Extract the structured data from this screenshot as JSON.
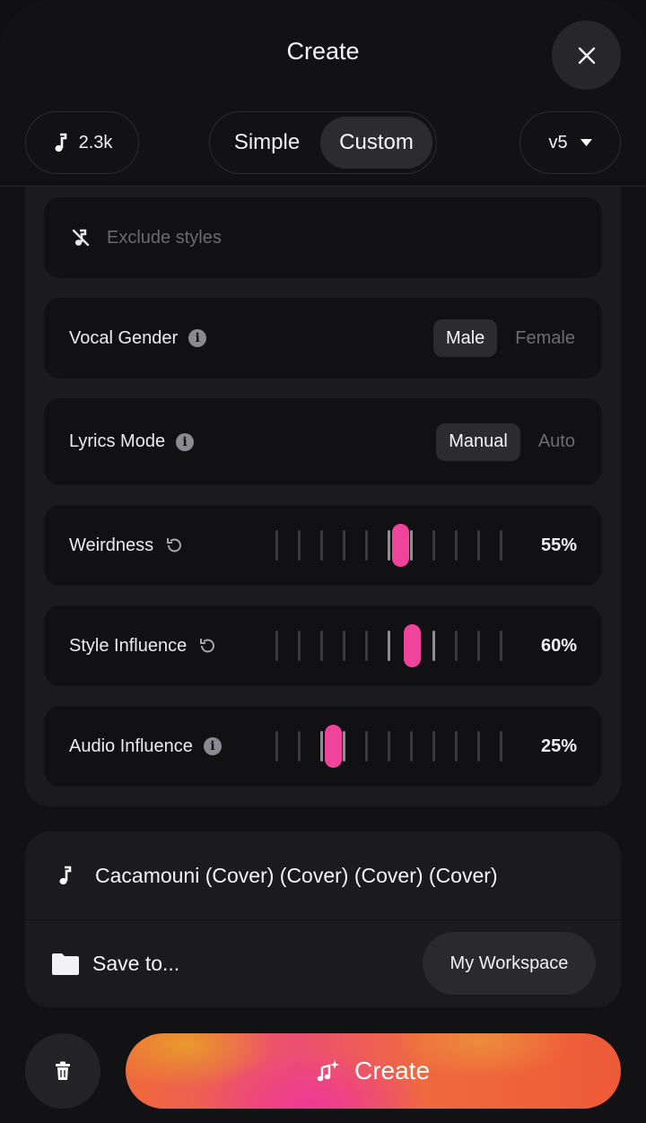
{
  "header": {
    "title": "Create"
  },
  "toolbar": {
    "credits": "2.3k",
    "modes": [
      "Simple",
      "Custom"
    ],
    "active_mode": "Custom",
    "version": "v5"
  },
  "exclude": {
    "placeholder": "Exclude styles"
  },
  "vocal_gender": {
    "label": "Vocal Gender",
    "options": [
      "Male",
      "Female"
    ],
    "selected": "Male"
  },
  "lyrics_mode": {
    "label": "Lyrics Mode",
    "options": [
      "Manual",
      "Auto"
    ],
    "selected": "Manual"
  },
  "sliders": [
    {
      "label": "Weirdness",
      "value_text": "55%",
      "value": 0.55,
      "icon": "reset-icon"
    },
    {
      "label": "Style Influence",
      "value_text": "60%",
      "value": 0.6,
      "icon": "reset-icon"
    },
    {
      "label": "Audio Influence",
      "value_text": "25%",
      "value": 0.25,
      "icon": "info-icon"
    }
  ],
  "song": {
    "title": "Cacamouni (Cover) (Cover) (Cover) (Cover)"
  },
  "save": {
    "label": "Save to...",
    "workspace": "My Workspace"
  },
  "actions": {
    "create_label": "Create"
  },
  "colors": {
    "accent": "#f0449c",
    "background": "#121214",
    "card": "#111113",
    "panel": "#1b1b1e"
  }
}
